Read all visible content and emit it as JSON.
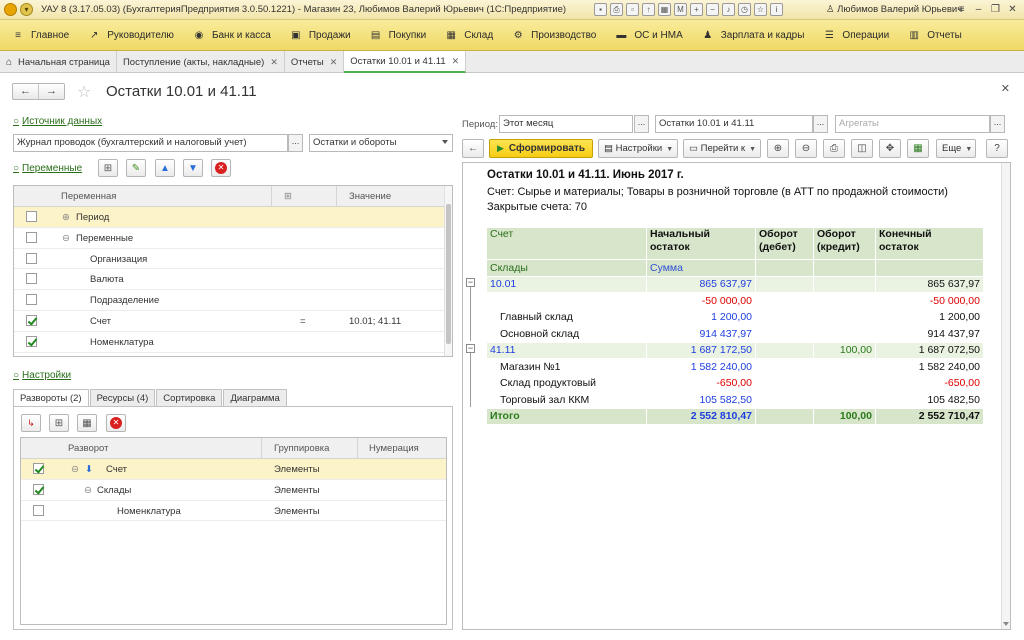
{
  "titlebar": {
    "title": "УАУ 8 (3.17.05.03) (БухгалтерияПредприятия 3.0.50.1221) - Магазин 23, Любимов Валерий Юрьевич (1С:Предприятие)",
    "user": "Любимов Валерий Юрьевич"
  },
  "sections": [
    {
      "icon": "≡",
      "label": "Главное"
    },
    {
      "icon": "↗",
      "label": "Руководителю"
    },
    {
      "icon": "◉",
      "label": "Банк и касса"
    },
    {
      "icon": "▣",
      "label": "Продажи"
    },
    {
      "icon": "▤",
      "label": "Покупки"
    },
    {
      "icon": "▦",
      "label": "Склад"
    },
    {
      "icon": "⚙",
      "label": "Производство"
    },
    {
      "icon": "▬",
      "label": "ОС и НМА"
    },
    {
      "icon": "♟",
      "label": "Зарплата и кадры"
    },
    {
      "icon": "☰",
      "label": "Операции"
    },
    {
      "icon": "▥",
      "label": "Отчеты"
    }
  ],
  "tabs": [
    {
      "label": "Начальная страница"
    },
    {
      "label": "Поступление (акты, накладные)"
    },
    {
      "label": "Отчеты"
    },
    {
      "label": "Остатки 10.01 и 41.11"
    }
  ],
  "form": {
    "title": "Остатки 10.01 и 41.11"
  },
  "left": {
    "data_source_link": "Источник данных",
    "data_source_value": "Журнал проводок (бухгалтерский и налоговый учет)",
    "data_source_kind": "Остатки и обороты",
    "variables_link": "Переменные",
    "variables_columns": [
      "Переменная",
      "Значение"
    ],
    "variables_rows": [
      {
        "name": "Период",
        "op": "",
        "value": "",
        "checked": false
      },
      {
        "name": "Переменные",
        "op": "",
        "value": "",
        "checked": false
      },
      {
        "name": "Организация",
        "op": "",
        "value": "",
        "checked": false
      },
      {
        "name": "Валюта",
        "op": "",
        "value": "",
        "checked": false
      },
      {
        "name": "Подразделение",
        "op": "",
        "value": "",
        "checked": false
      },
      {
        "name": "Счет",
        "op": "=",
        "value": "10.01; 41.11",
        "checked": true
      },
      {
        "name": "Номенклатура",
        "op": "",
        "value": "",
        "checked": true
      }
    ],
    "settings_link": "Настройки",
    "subtabs": [
      "Развороты (2)",
      "Ресурсы (4)",
      "Сортировка",
      "Диаграмма"
    ],
    "breakdown_columns": [
      "Разворот",
      "Группировка",
      "Нумерация"
    ],
    "breakdown_rows": [
      {
        "name": "Счет",
        "grouping": "Элементы",
        "checked": true
      },
      {
        "name": "Склады",
        "grouping": "Элементы",
        "checked": true
      },
      {
        "name": "Номенклатура",
        "grouping": "Элементы",
        "checked": false
      }
    ]
  },
  "right": {
    "period_label": "Период:",
    "period_value": "Этот месяц",
    "report_name": "Остатки 10.01 и 41.11",
    "aggregates_placeholder": "Агрегаты",
    "generate_button": "Сформировать",
    "settings_button": "Настройки",
    "goto_button": "Перейти к",
    "more_button": "Еще",
    "help_button": "?"
  },
  "report": {
    "title": "Остатки 10.01 и 41.11. Июнь 2017 г.",
    "account_line": "Счет: Сырье и материалы; Товары в розничной торговле (в АТТ по продажной стоимости)",
    "closed_line": "Закрытые счета: 70",
    "head": {
      "account": "Счет",
      "opening1": "Начальный",
      "opening2": "остаток",
      "debit1": "Оборот",
      "debit2": "(дебет)",
      "credit1": "Оборот",
      "credit2": "(кредит)",
      "closing1": "Конечный",
      "closing2": "остаток",
      "warehouses": "Склады",
      "sum": "Сумма"
    },
    "rows": [
      {
        "name": "10.01",
        "opening": "865 637,97",
        "debit": "",
        "credit": "",
        "closing": "865 637,97",
        "group": true
      },
      {
        "name": "",
        "opening": "-50 000,00",
        "debit": "",
        "credit": "",
        "closing": "-50 000,00",
        "group": false
      },
      {
        "name": "Главный склад",
        "opening": "1 200,00",
        "debit": "",
        "credit": "",
        "closing": "1 200,00",
        "group": false
      },
      {
        "name": "Основной склад",
        "opening": "914 437,97",
        "debit": "",
        "credit": "",
        "closing": "914 437,97",
        "group": false
      },
      {
        "name": "41.11",
        "opening": "1 687 172,50",
        "debit": "",
        "credit": "100,00",
        "closing": "1 687 072,50",
        "group": true
      },
      {
        "name": "Магазин №1",
        "opening": "1 582 240,00",
        "debit": "",
        "credit": "",
        "closing": "1 582 240,00",
        "group": false
      },
      {
        "name": "Склад продуктовый",
        "opening": "-650,00",
        "debit": "",
        "credit": "",
        "closing": "-650,00",
        "group": false
      },
      {
        "name": "Торговый зал ККМ",
        "opening": "105 582,50",
        "debit": "",
        "credit": "",
        "closing": "105 482,50",
        "group": false
      }
    ],
    "total": {
      "name": "Итого",
      "opening": "2 552 810,47",
      "debit": "",
      "credit": "100,00",
      "closing": "2 552 710,47"
    }
  }
}
